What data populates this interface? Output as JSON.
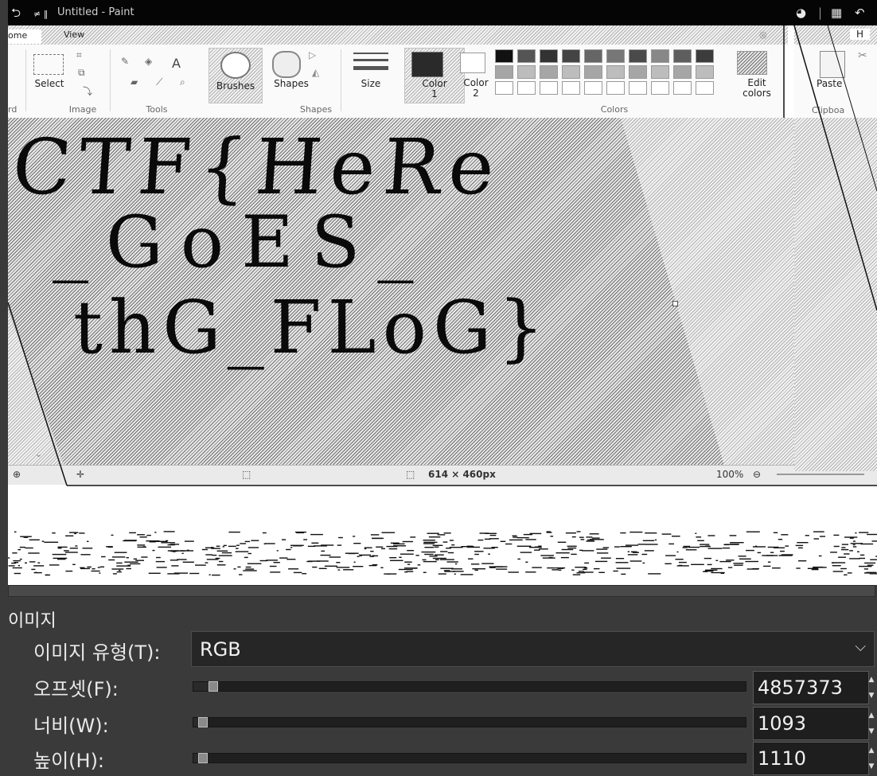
{
  "paint_window": {
    "title": "Untitled - Paint",
    "tabs": [
      {
        "label": "ome"
      },
      {
        "label": "View"
      }
    ],
    "ribbon": {
      "groups": [
        {
          "label": "rd"
        },
        {
          "label": "Image"
        },
        {
          "label": "Tools"
        },
        {
          "label": "Shapes"
        },
        {
          "label": "Colors"
        }
      ],
      "buttons": {
        "select": "Select",
        "brushes": "Brushes",
        "shapes": "Shapes",
        "size": "Size",
        "color1_line1": "Color",
        "color1_line2": "1",
        "color2_line1": "Color",
        "color2_line2": "2",
        "edit_colors_line1": "Edit",
        "edit_colors_line2": "colors"
      },
      "tool_glyph_text": "A"
    },
    "canvas_text": {
      "line1": "CTF{HeRe",
      "line2": "_GoES_",
      "line3": "thG_FLoG}"
    },
    "statusbar": {
      "dimensions": "614 × 460px",
      "zoom": "100%"
    },
    "right_panel": {
      "tab_label": "H",
      "paste": "Paste",
      "clipboard": "Clipboa"
    }
  },
  "image_settings": {
    "section_title": "이미지",
    "image_type": {
      "label": "이미지 유형(T):",
      "value": "RGB"
    },
    "offset": {
      "label": "오프셋(F):",
      "value": "4857373",
      "level": 0.02
    },
    "width": {
      "label": "너비(W):",
      "value": "1093",
      "level": 0.0
    },
    "height": {
      "label": "높이(H):",
      "value": "1110",
      "level": 0.0
    }
  },
  "icons": [
    "back-arrow-icon",
    "save-icon",
    "undo-icon",
    "chevron-down-icon",
    "spin-up-icon",
    "spin-down-icon",
    "zoom-out-icon"
  ]
}
